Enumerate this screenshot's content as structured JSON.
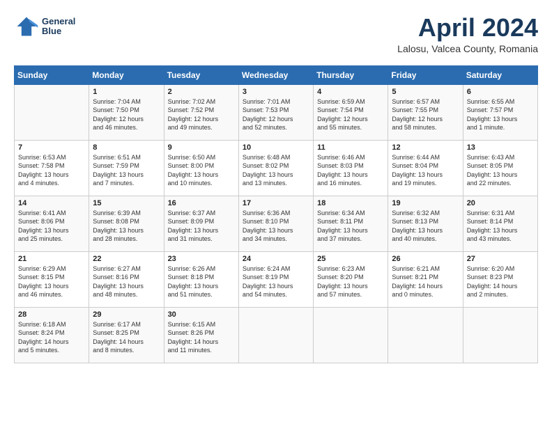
{
  "header": {
    "logo_line1": "General",
    "logo_line2": "Blue",
    "month": "April 2024",
    "location": "Lalosu, Valcea County, Romania"
  },
  "weekdays": [
    "Sunday",
    "Monday",
    "Tuesday",
    "Wednesday",
    "Thursday",
    "Friday",
    "Saturday"
  ],
  "weeks": [
    [
      {
        "day": "",
        "info": ""
      },
      {
        "day": "1",
        "info": "Sunrise: 7:04 AM\nSunset: 7:50 PM\nDaylight: 12 hours\nand 46 minutes."
      },
      {
        "day": "2",
        "info": "Sunrise: 7:02 AM\nSunset: 7:52 PM\nDaylight: 12 hours\nand 49 minutes."
      },
      {
        "day": "3",
        "info": "Sunrise: 7:01 AM\nSunset: 7:53 PM\nDaylight: 12 hours\nand 52 minutes."
      },
      {
        "day": "4",
        "info": "Sunrise: 6:59 AM\nSunset: 7:54 PM\nDaylight: 12 hours\nand 55 minutes."
      },
      {
        "day": "5",
        "info": "Sunrise: 6:57 AM\nSunset: 7:55 PM\nDaylight: 12 hours\nand 58 minutes."
      },
      {
        "day": "6",
        "info": "Sunrise: 6:55 AM\nSunset: 7:57 PM\nDaylight: 13 hours\nand 1 minute."
      }
    ],
    [
      {
        "day": "7",
        "info": "Sunrise: 6:53 AM\nSunset: 7:58 PM\nDaylight: 13 hours\nand 4 minutes."
      },
      {
        "day": "8",
        "info": "Sunrise: 6:51 AM\nSunset: 7:59 PM\nDaylight: 13 hours\nand 7 minutes."
      },
      {
        "day": "9",
        "info": "Sunrise: 6:50 AM\nSunset: 8:00 PM\nDaylight: 13 hours\nand 10 minutes."
      },
      {
        "day": "10",
        "info": "Sunrise: 6:48 AM\nSunset: 8:02 PM\nDaylight: 13 hours\nand 13 minutes."
      },
      {
        "day": "11",
        "info": "Sunrise: 6:46 AM\nSunset: 8:03 PM\nDaylight: 13 hours\nand 16 minutes."
      },
      {
        "day": "12",
        "info": "Sunrise: 6:44 AM\nSunset: 8:04 PM\nDaylight: 13 hours\nand 19 minutes."
      },
      {
        "day": "13",
        "info": "Sunrise: 6:43 AM\nSunset: 8:05 PM\nDaylight: 13 hours\nand 22 minutes."
      }
    ],
    [
      {
        "day": "14",
        "info": "Sunrise: 6:41 AM\nSunset: 8:06 PM\nDaylight: 13 hours\nand 25 minutes."
      },
      {
        "day": "15",
        "info": "Sunrise: 6:39 AM\nSunset: 8:08 PM\nDaylight: 13 hours\nand 28 minutes."
      },
      {
        "day": "16",
        "info": "Sunrise: 6:37 AM\nSunset: 8:09 PM\nDaylight: 13 hours\nand 31 minutes."
      },
      {
        "day": "17",
        "info": "Sunrise: 6:36 AM\nSunset: 8:10 PM\nDaylight: 13 hours\nand 34 minutes."
      },
      {
        "day": "18",
        "info": "Sunrise: 6:34 AM\nSunset: 8:11 PM\nDaylight: 13 hours\nand 37 minutes."
      },
      {
        "day": "19",
        "info": "Sunrise: 6:32 AM\nSunset: 8:13 PM\nDaylight: 13 hours\nand 40 minutes."
      },
      {
        "day": "20",
        "info": "Sunrise: 6:31 AM\nSunset: 8:14 PM\nDaylight: 13 hours\nand 43 minutes."
      }
    ],
    [
      {
        "day": "21",
        "info": "Sunrise: 6:29 AM\nSunset: 8:15 PM\nDaylight: 13 hours\nand 46 minutes."
      },
      {
        "day": "22",
        "info": "Sunrise: 6:27 AM\nSunset: 8:16 PM\nDaylight: 13 hours\nand 48 minutes."
      },
      {
        "day": "23",
        "info": "Sunrise: 6:26 AM\nSunset: 8:18 PM\nDaylight: 13 hours\nand 51 minutes."
      },
      {
        "day": "24",
        "info": "Sunrise: 6:24 AM\nSunset: 8:19 PM\nDaylight: 13 hours\nand 54 minutes."
      },
      {
        "day": "25",
        "info": "Sunrise: 6:23 AM\nSunset: 8:20 PM\nDaylight: 13 hours\nand 57 minutes."
      },
      {
        "day": "26",
        "info": "Sunrise: 6:21 AM\nSunset: 8:21 PM\nDaylight: 14 hours\nand 0 minutes."
      },
      {
        "day": "27",
        "info": "Sunrise: 6:20 AM\nSunset: 8:23 PM\nDaylight: 14 hours\nand 2 minutes."
      }
    ],
    [
      {
        "day": "28",
        "info": "Sunrise: 6:18 AM\nSunset: 8:24 PM\nDaylight: 14 hours\nand 5 minutes."
      },
      {
        "day": "29",
        "info": "Sunrise: 6:17 AM\nSunset: 8:25 PM\nDaylight: 14 hours\nand 8 minutes."
      },
      {
        "day": "30",
        "info": "Sunrise: 6:15 AM\nSunset: 8:26 PM\nDaylight: 14 hours\nand 11 minutes."
      },
      {
        "day": "",
        "info": ""
      },
      {
        "day": "",
        "info": ""
      },
      {
        "day": "",
        "info": ""
      },
      {
        "day": "",
        "info": ""
      }
    ]
  ]
}
